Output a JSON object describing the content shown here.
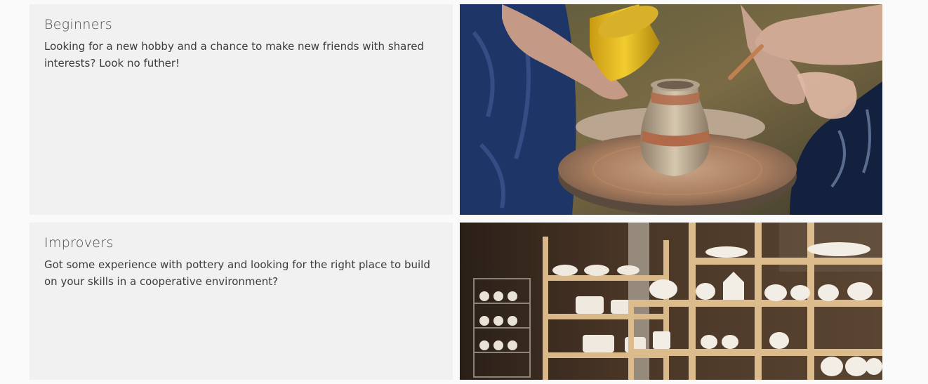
{
  "cards": [
    {
      "title": "Beginners",
      "body": "Looking for a new hobby and a chance to make new friends with shared interests? Look no futher!"
    },
    {
      "title": "Improvers",
      "body": "Got some experience with pottery and looking for the right place to build on your skills in a cooperative environment?"
    }
  ]
}
